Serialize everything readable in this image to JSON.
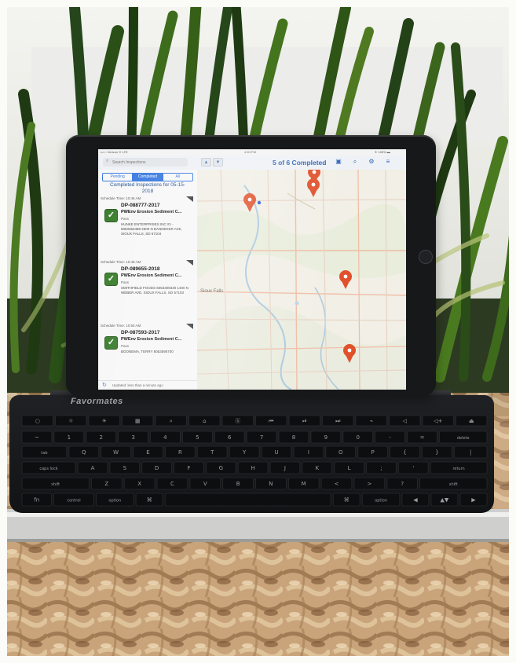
{
  "device": {
    "keyboard_brand": "Favormates"
  },
  "status_bar": {
    "carrier": "••○○ Verizon ✈ LTE",
    "time": "4:53 PM",
    "battery": "✈ 100% ▬"
  },
  "toolbar": {
    "search_placeholder": "Search Inspections",
    "title": "5 of 6 Completed",
    "up_label": "▲",
    "down_label": "▼"
  },
  "segments": [
    {
      "label": "Pending",
      "active": false
    },
    {
      "label": "Completed",
      "active": true
    },
    {
      "label": "All",
      "active": false
    }
  ],
  "section_title": "Completed Inspections for 05-15-2018",
  "inspections": [
    {
      "time": "Schedule Time: 10:46 AM",
      "id": "DP-088777-2017",
      "title": "PWEnv Erosion Sediment C...",
      "status": "Pass",
      "address": "HUNKE ENTERPRISES INC #1 - 6053353488 2500 N BANNEKER AVE, SIOUX FALLS, SD 57104"
    },
    {
      "time": "Schedule Time: 10:48 AM",
      "id": "DP-089655-2018",
      "title": "PWEnv Erosion Sediment C...",
      "status": "Pass",
      "address": "SMITHFIELD FOODS 6053308330 1400 N WEBER AVE, SIOUX FALLS, SD 57103"
    },
    {
      "time": "Schedule Time: 10:50 AM",
      "id": "DP-087593-2017",
      "title": "PWEnv Erosion Sediment C...",
      "status": "Pass",
      "address": "BOONEMA, TERRY 6053595700"
    }
  ],
  "footer": {
    "updated": "Updated: less than a minute ago"
  },
  "map": {
    "place_label": "Sioux Falls",
    "pin_color": "#e0512b"
  },
  "keyboard": {
    "rows": [
      [
        "○",
        "☼",
        "☀",
        "▦",
        "⌕",
        "⌂",
        "ⓑ",
        "⏮",
        "⏯",
        "⏭",
        "⌁",
        "◁",
        "◁+",
        "⏏"
      ],
      [
        "~",
        "1",
        "2",
        "3",
        "4",
        "5",
        "6",
        "7",
        "8",
        "9",
        "0",
        "-",
        "=",
        "delete"
      ],
      [
        "tab",
        "Q",
        "W",
        "E",
        "R",
        "T",
        "Y",
        "U",
        "I",
        "O",
        "P",
        "{",
        "}",
        "|"
      ],
      [
        "caps lock",
        "A",
        "S",
        "D",
        "F",
        "G",
        "H",
        "J",
        "K",
        "L",
        ";",
        "'",
        "return"
      ],
      [
        "shift",
        "Z",
        "X",
        "C",
        "V",
        "B",
        "N",
        "M",
        "<",
        ">",
        "?",
        "shift"
      ],
      [
        "fn",
        "control",
        "option",
        "⌘",
        "",
        "⌘",
        "option",
        "◀",
        "▲▼",
        "▶"
      ]
    ]
  }
}
